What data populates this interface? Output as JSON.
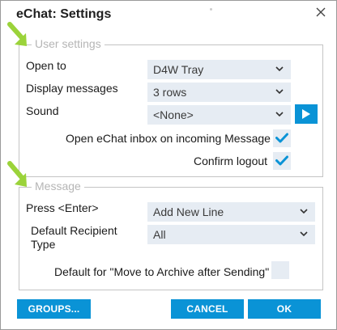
{
  "dialog": {
    "title": "eChat: Settings"
  },
  "user_settings": {
    "legend": "User settings",
    "open_to_label": "Open to",
    "open_to_value": "D4W Tray",
    "display_messages_label": "Display messages",
    "display_messages_value": "3 rows",
    "sound_label": "Sound",
    "sound_value": "<None>",
    "open_inbox_label": "Open eChat inbox on incoming Message",
    "open_inbox_checked": true,
    "confirm_logout_label": "Confirm logout",
    "confirm_logout_checked": true
  },
  "message": {
    "legend": "Message",
    "press_enter_label": "Press <Enter>",
    "press_enter_value": "Add New Line",
    "default_recipient_label_line1": "Default Recipient",
    "default_recipient_label_line2": "Type",
    "default_recipient_value": "All",
    "archive_label": "Default for \"Move to Archive after Sending\"",
    "archive_checked": false
  },
  "footer": {
    "groups_label": "GROUPS...",
    "cancel_label": "CANCEL",
    "ok_label": "OK"
  },
  "colors": {
    "accent": "#0a93d6",
    "field_bg": "#e6ecf3",
    "arrow_green": "#9bd33a"
  }
}
